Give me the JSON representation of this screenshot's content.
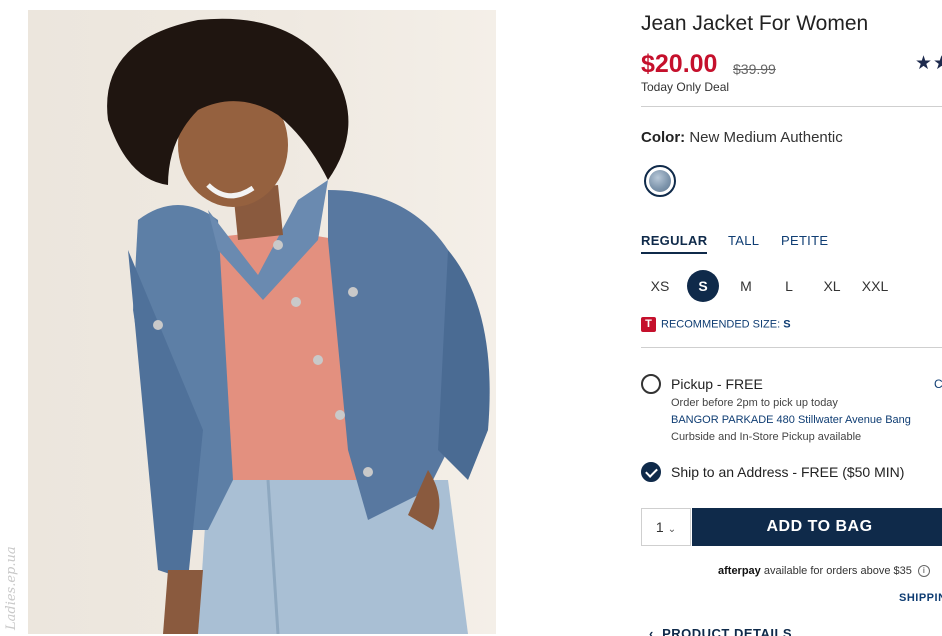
{
  "product": {
    "title": "Jean Jacket For Women",
    "price": "$20.00",
    "original_price": "$39.99",
    "deal_label": "Today Only Deal",
    "rating_stars": "★★",
    "color_label": "Color:",
    "color_value": "New Medium Authentic"
  },
  "fit_tabs": [
    {
      "label": "REGULAR",
      "active": true
    },
    {
      "label": "TALL",
      "active": false
    },
    {
      "label": "PETITE",
      "active": false
    }
  ],
  "sizes": [
    "XS",
    "S",
    "M",
    "L",
    "XL",
    "XXL"
  ],
  "selected_size": "S",
  "recommended": {
    "icon_text": "T",
    "label": "RECOMMENDED SIZE:",
    "value": "S"
  },
  "fulfillment": {
    "pickup_label": "Pickup - FREE",
    "pickup_note": "Order before 2pm to pick up today",
    "store": "BANGOR PARKADE 480 Stillwater Avenue  Bang",
    "curbside": "Curbside and In-Store Pickup available",
    "change_link": "C",
    "ship_label": "Ship to an Address - FREE ($50 MIN)"
  },
  "cart": {
    "quantity": "1",
    "add_label": "ADD TO BAG"
  },
  "afterpay": {
    "logo": "afterpay",
    "text": "available for orders above $35",
    "info_icon": "i"
  },
  "shipping_link": "SHIPPIN",
  "product_details": "PRODUCT DETAILS",
  "watermark": "Ladies.ep.ua",
  "colors": {
    "accent": "#0f2a4a",
    "price": "#c5102c"
  }
}
